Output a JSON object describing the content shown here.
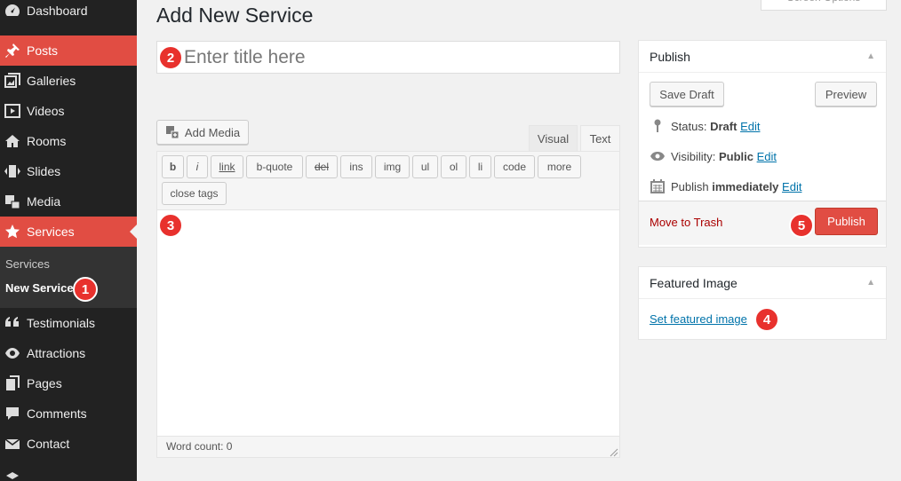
{
  "sidebar": {
    "items": [
      {
        "label": "Dashboard",
        "icon": "dashboard-icon"
      },
      {
        "label": "Posts",
        "icon": "pushpin-icon"
      },
      {
        "label": "Galleries",
        "icon": "gallery-icon"
      },
      {
        "label": "Videos",
        "icon": "video-icon"
      },
      {
        "label": "Rooms",
        "icon": "home-icon"
      },
      {
        "label": "Slides",
        "icon": "slides-icon"
      },
      {
        "label": "Media",
        "icon": "media-icon"
      },
      {
        "label": "Services",
        "icon": "star-icon"
      },
      {
        "label": "Testimonials",
        "icon": "quote-icon"
      },
      {
        "label": "Attractions",
        "icon": "eye-icon"
      },
      {
        "label": "Pages",
        "icon": "pages-icon"
      },
      {
        "label": "Comments",
        "icon": "comment-icon"
      },
      {
        "label": "Contact",
        "icon": "envelope-icon"
      }
    ],
    "submenu": [
      {
        "label": "Services"
      },
      {
        "label": "New Service"
      }
    ],
    "accent_color": "#e14d43"
  },
  "header": {
    "page_title": "Add New Service",
    "screen_options": "Screen Options"
  },
  "title_field": {
    "placeholder": "Enter title here",
    "value": ""
  },
  "editor": {
    "add_media_label": "Add Media",
    "tabs": [
      {
        "label": "Visual"
      },
      {
        "label": "Text"
      }
    ],
    "active_tab": "Text",
    "quicktags": [
      "b",
      "i",
      "link",
      "b-quote",
      "del",
      "ins",
      "img",
      "ul",
      "ol",
      "li",
      "code",
      "more",
      "close tags"
    ],
    "content": "",
    "word_count": "Word count: 0"
  },
  "publish_box": {
    "title": "Publish",
    "save_draft": "Save Draft",
    "preview": "Preview",
    "status_label": "Status:",
    "status_value": "Draft",
    "visibility_label": "Visibility:",
    "visibility_value": "Public",
    "publish_label": "Publish",
    "publish_value": "immediately",
    "edit_link": "Edit",
    "move_to_trash": "Move to Trash",
    "publish_button": "Publish"
  },
  "featured_image_box": {
    "title": "Featured Image",
    "set_link": "Set featured image"
  },
  "badges": [
    "1",
    "2",
    "3",
    "4",
    "5"
  ]
}
